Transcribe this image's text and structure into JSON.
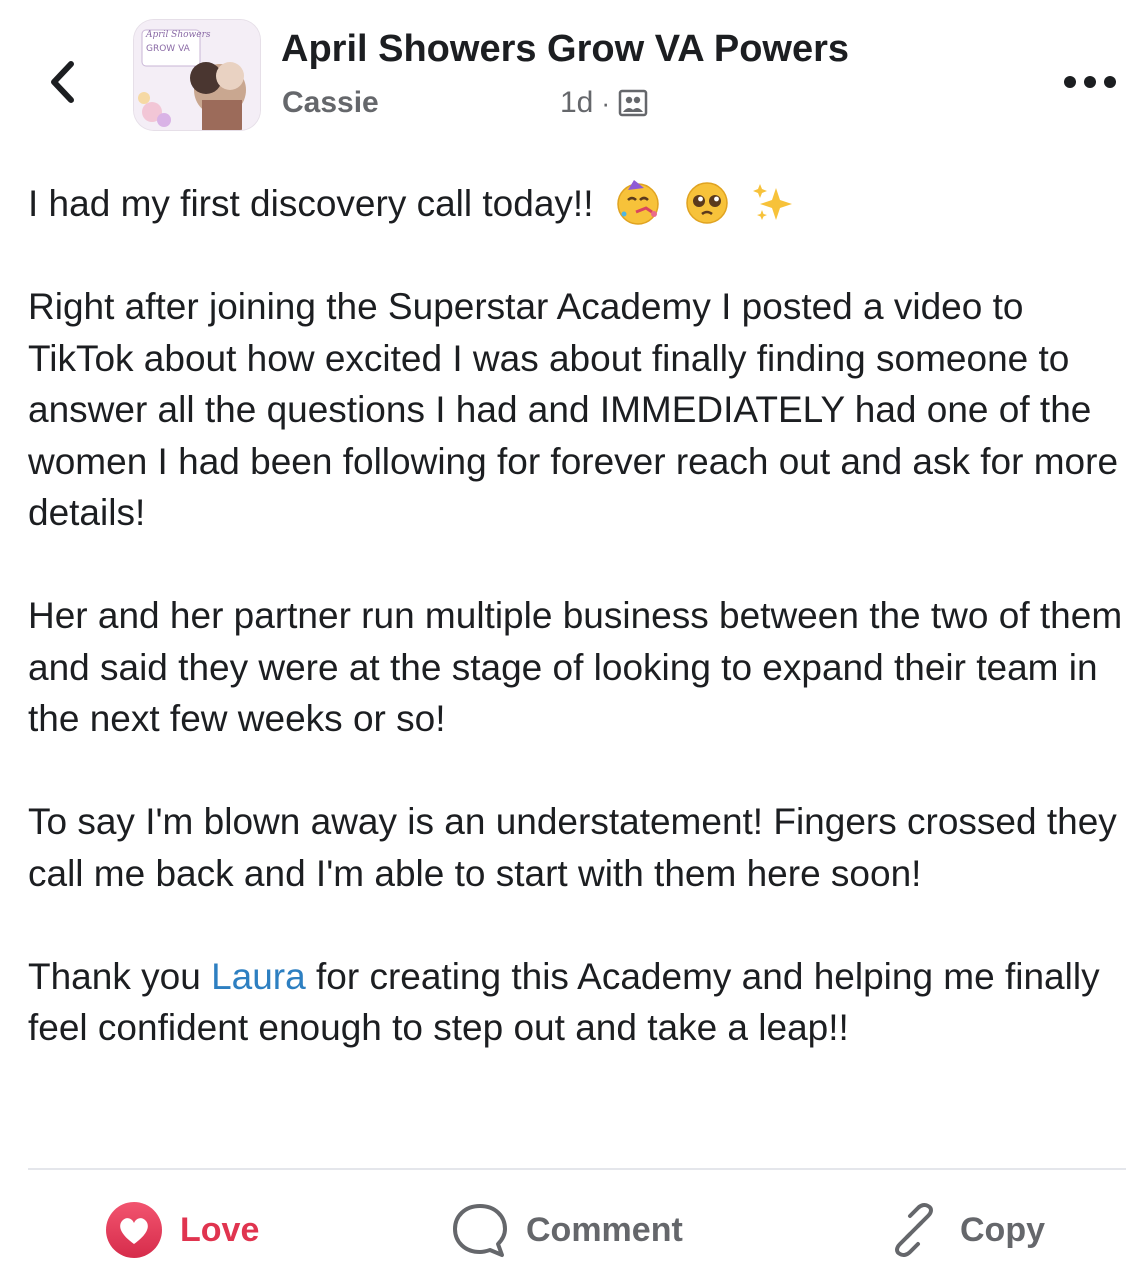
{
  "header": {
    "group_name": "April Showers Grow VA Powers",
    "author": "Cassie",
    "timestamp": "1d",
    "separator": "·",
    "privacy_icon": "members-group-icon",
    "back_icon": "chevron-left-icon",
    "more_icon": "more-options-icon",
    "avatar_text_line1": "April Showers",
    "avatar_text_line2": "GROW VA"
  },
  "post": {
    "line1": "I had my first discovery call today!!",
    "line1_emojis": [
      "partying-face-emoji",
      "pleading-face-emoji",
      "sparkles-emoji"
    ],
    "para2": "Right after joining the Superstar Academy I posted a video to TikTok about how excited I was about finally finding someone to answer all the questions I had and IMMEDIATELY had one of the women I had been following for forever reach out and ask for more details!",
    "para3": "Her and her partner run multiple business between the two of them and said they were at the stage of looking to expand their team in the next few weeks or so!",
    "para4": "To say I'm blown away is an understatement! Fingers crossed they call me back and I'm able to start with them here soon!",
    "para5_before": "Thank you ",
    "para5_mention": "Laura",
    "para5_after": " for creating this Academy and helping me finally feel confident enough to step out and take a leap!!"
  },
  "actions": {
    "love_label": "Love",
    "comment_label": "Comment",
    "copy_label": "Copy"
  },
  "colors": {
    "love": "#e0344f",
    "mention": "#2d7fc1",
    "secondary_text": "#65676b"
  }
}
